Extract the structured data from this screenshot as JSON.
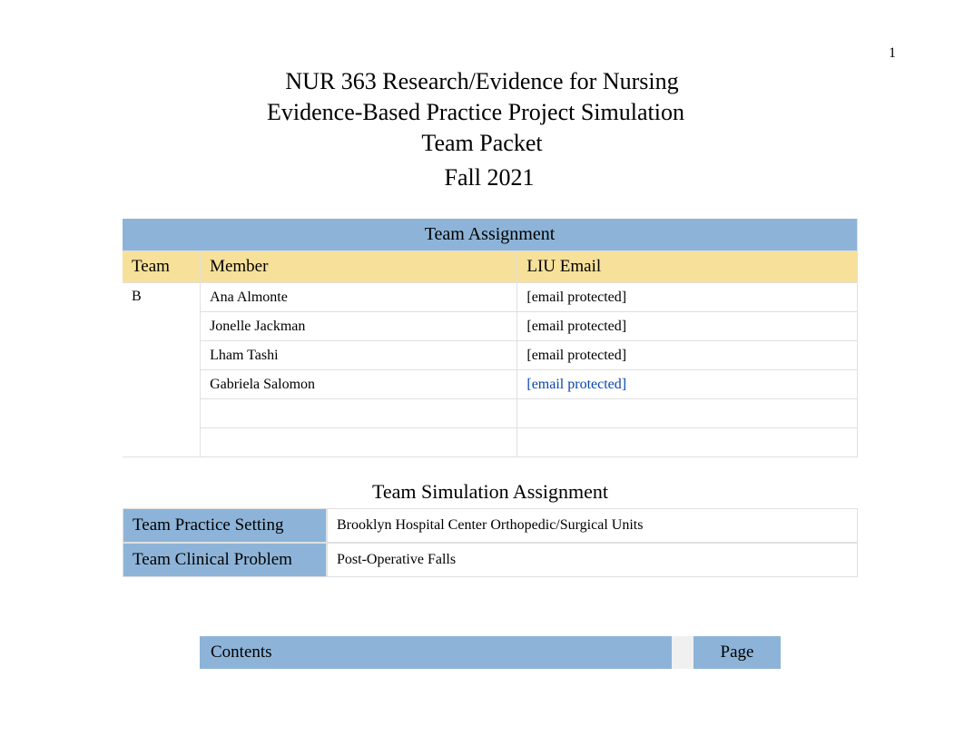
{
  "page_number": "1",
  "header": {
    "line1": "NUR 363 Research/Evidence for Nursing",
    "line2": "Evidence-Based Practice Project Simulation",
    "line3": "Team Packet",
    "line4": "Fall 2021"
  },
  "team_assignment": {
    "title": "Team Assignment",
    "columns": {
      "team": "Team",
      "member": "Member",
      "email": "LIU Email"
    },
    "team_letter": "B",
    "rows": [
      {
        "member": "Ana Almonte",
        "email": "[email protected]",
        "is_link": false
      },
      {
        "member": "Jonelle Jackman",
        "email": "[email protected]",
        "is_link": false
      },
      {
        "member": "Lham Tashi",
        "email": "[email protected]",
        "is_link": false
      },
      {
        "member": "Gabriela Salomon",
        "email": "[email protected]",
        "is_link": true
      },
      {
        "member": "",
        "email": "",
        "is_link": false
      },
      {
        "member": "",
        "email": "",
        "is_link": false
      }
    ]
  },
  "simulation": {
    "title": "Team Simulation Assignment",
    "practice_label": "Team Practice Setting",
    "practice_value": "Brooklyn Hospital Center Orthopedic/Surgical Units",
    "problem_label": "Team Clinical Problem",
    "problem_value": "Post-Operative Falls"
  },
  "toc": {
    "contents": "Contents",
    "page": "Page"
  }
}
